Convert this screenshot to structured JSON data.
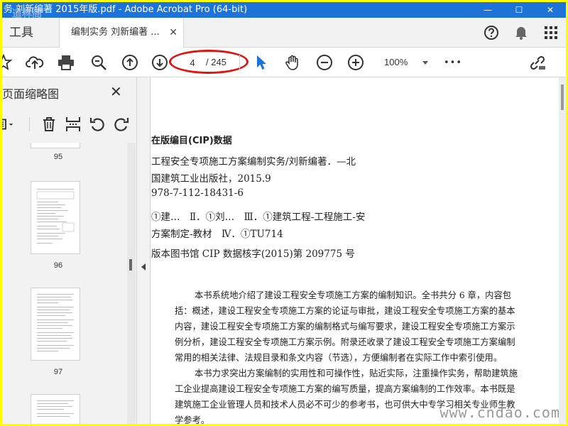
{
  "window": {
    "title": "务 刘新编著 2015年版.pdf - Adobe Acrobat Pro (64-bit)",
    "logo_text": "道林阁",
    "minimize": "—",
    "maximize": "☐",
    "close": "✕"
  },
  "tabs": {
    "tools_label": "工具",
    "doc_label": "编制实务 刘新编著 ...",
    "doc_close": "✕"
  },
  "toolbar": {
    "page_current": "4",
    "page_total": "/ 245",
    "zoom": "100%",
    "more": "•••"
  },
  "left_panel": {
    "title": "页面缩略图",
    "close": "✕",
    "thumbnails": [
      {
        "label": "95"
      },
      {
        "label": "96"
      },
      {
        "label": "97"
      }
    ]
  },
  "document": {
    "cip_lines": [
      "在版编目(CIP)数据",
      "工程安全专项施工方案编制实务/刘新编著．—北",
      "国建筑工业出版社，2015.9",
      "978-7-112-18431-6",
      "①建…　Ⅱ．①刘…　Ⅲ．①建筑工程-工程施工-安",
      "方案制定-教材　Ⅳ．①TU714",
      "版本图书馆 CIP 数据核字(2015)第 209775 号"
    ],
    "body_lines": [
      "本书系统地介绍了建设工程安全专项施工方案的编制知识。全书共分 6 章，内容包",
      "括：概述，建设工程安全专项施工方案的论证与审批，建设工程安全专项施工方案的基本",
      "内容，建设工程安全专项施工方案的编制格式与编写要求，建设工程安全专项施工方案示",
      "例分析，建设工程安全专项施工方案示例。附录还收录了建设工程安全专项施工方案编制",
      "常用的相关法律、法规目录和条文内容（节选），方便编制者在实际工作中索引使用。",
      "本书力求突出方案编制的实用性和可操作性，贴近实际，注重操作实务，帮助建筑施",
      "工企业提高建设工程安全专项施工方案的编写质量，提高方案编制的工作效率。本书既是",
      "建筑施工企业管理人员和技术人员必不可少的参考书，也可供大中专学习相关专业师生教",
      "学参考。"
    ],
    "watermark": "www.cndao.com"
  },
  "colors": {
    "title_bar": "#1e73d8",
    "highlight_oval": "#d81919",
    "select_arrow": "#1e73d8",
    "border": "#ffff00"
  },
  "icons": {
    "toolbar": [
      "star-icon",
      "upload-icon",
      "print-icon",
      "zoom-search-icon",
      "prev-page-icon",
      "next-page-icon",
      "select-arrow-icon",
      "hand-icon",
      "zoom-out-icon",
      "zoom-in-icon",
      "share-link-icon"
    ],
    "tabrow": [
      "help-icon",
      "bell-icon",
      "apps-grid-icon"
    ],
    "panel": [
      "options-menu-icon",
      "delete-icon",
      "insert-icon",
      "undo-icon",
      "redo-icon"
    ]
  }
}
